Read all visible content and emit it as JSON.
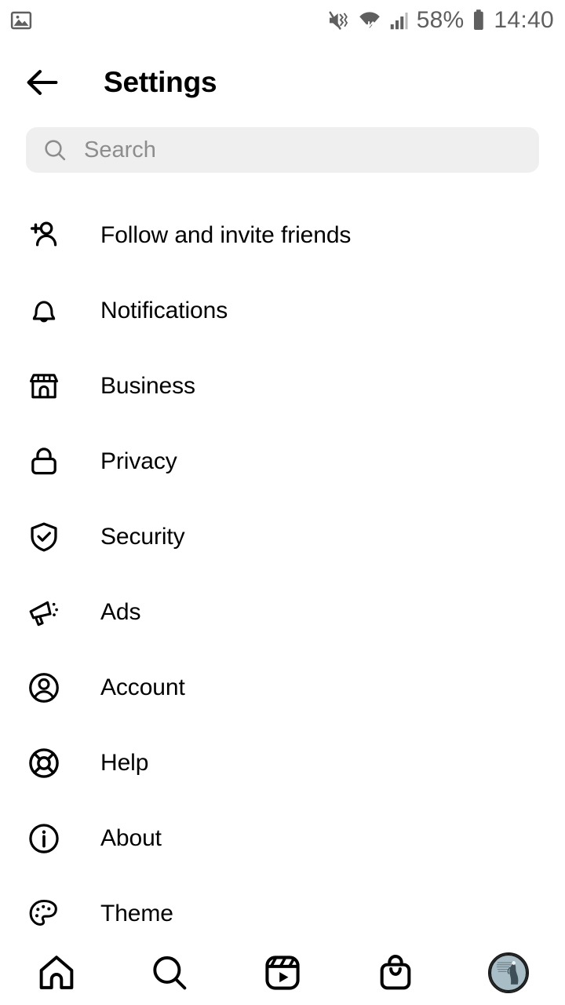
{
  "status_bar": {
    "left_icons": [
      {
        "name": "image-notification-icon",
        "glyph": "photo"
      }
    ],
    "right_icons": [
      {
        "name": "vibrate-mute-icon",
        "glyph": "speaker-mute"
      },
      {
        "name": "wifi-data-icon",
        "glyph": "wifi"
      },
      {
        "name": "cellular-signal-icon",
        "glyph": "signal-bars"
      }
    ],
    "battery_percent": "58%",
    "battery_icon": "battery-icon",
    "time": "14:40"
  },
  "header": {
    "back_icon": "back-arrow-icon",
    "title": "Settings"
  },
  "search": {
    "icon": "search-icon",
    "placeholder": "Search",
    "value": ""
  },
  "settings_list": [
    {
      "icon": "person-add-icon",
      "label": "Follow and invite friends"
    },
    {
      "icon": "bell-icon",
      "label": "Notifications"
    },
    {
      "icon": "storefront-icon",
      "label": "Business"
    },
    {
      "icon": "lock-icon",
      "label": "Privacy"
    },
    {
      "icon": "shield-check-icon",
      "label": "Security"
    },
    {
      "icon": "megaphone-icon",
      "label": "Ads"
    },
    {
      "icon": "account-circle-icon",
      "label": "Account"
    },
    {
      "icon": "life-ring-icon",
      "label": "Help"
    },
    {
      "icon": "info-circle-icon",
      "label": "About"
    },
    {
      "icon": "palette-icon",
      "label": "Theme"
    }
  ],
  "bottom_nav": [
    {
      "name": "nav-home",
      "icon": "home-icon"
    },
    {
      "name": "nav-search",
      "icon": "search-icon"
    },
    {
      "name": "nav-reels",
      "icon": "reels-icon"
    },
    {
      "name": "nav-shop",
      "icon": "shopping-bag-icon"
    },
    {
      "name": "nav-profile",
      "icon": "profile-avatar"
    }
  ],
  "colors": {
    "background": "#ffffff",
    "text_primary": "#000000",
    "text_muted": "#8d8d8d",
    "search_bg": "#efefef",
    "status_icon": "#5f5f5f",
    "avatar_bg": "#a8bcc4"
  }
}
